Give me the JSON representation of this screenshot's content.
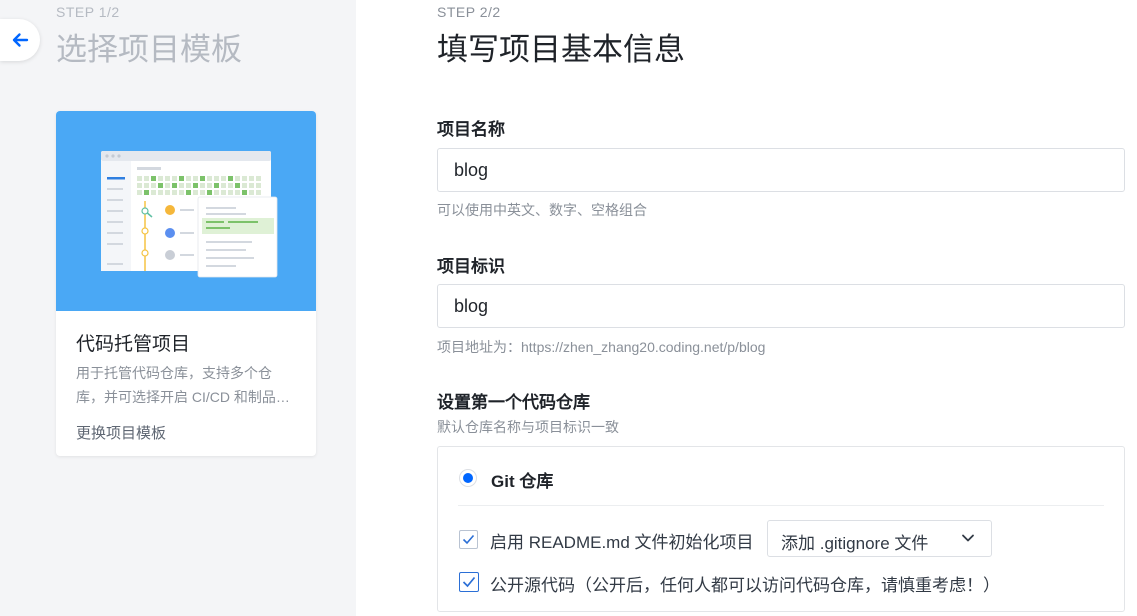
{
  "step1": {
    "label": "STEP 1/2",
    "title": "选择项目模板",
    "card": {
      "title": "代码托管项目",
      "description": "用于托管代码仓库，支持多个仓库，并可选择开启 CI/CD 和制品库等功能",
      "change_link": "更换项目模板"
    }
  },
  "step2": {
    "label": "STEP 2/2",
    "title": "填写项目基本信息",
    "project_name": {
      "label": "项目名称",
      "value": "blog",
      "hint": "可以使用中英文、数字、空格组合"
    },
    "project_id": {
      "label": "项目标识",
      "value": "blog",
      "hint": "项目地址为：https://zhen_zhang20.coding.net/p/blog"
    },
    "repo": {
      "label": "设置第一个代码仓库",
      "hint": "默认仓库名称与项目标识一致",
      "type_label": "Git 仓库",
      "readme_label": "启用 README.md 文件初始化项目",
      "gitignore_select": "添加 .gitignore 文件",
      "public_label": "公开源代码（公开后，任何人都可以访问代码仓库，请慎重考虑！）"
    }
  },
  "colors": {
    "accent": "#0066ff",
    "card_banner": "#4aa8f5",
    "left_bg": "#f4f5f7"
  }
}
